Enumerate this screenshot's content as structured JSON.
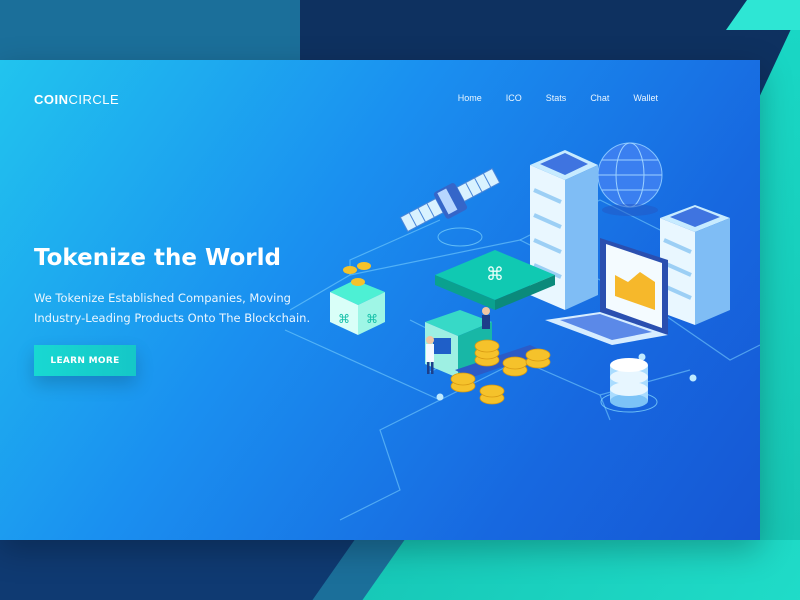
{
  "brand": {
    "logo_bold": "COIN",
    "logo_rest": "CIRCLE"
  },
  "nav": {
    "items": [
      "Home",
      "ICO",
      "Stats",
      "Chat",
      "Wallet"
    ]
  },
  "hero": {
    "title": "Tokenize the World",
    "subtitle": "We Tokenize Established Companies, Moving Industry-Leading Products Onto The Blockchain.",
    "cta_label": "LEARN MORE"
  },
  "colors": {
    "accent": "#18d8d2",
    "card_start": "#21c4ee",
    "card_end": "#1657d4",
    "navy": "#0e3160",
    "mint": "#19d8c6"
  },
  "illustration": {
    "icons": [
      "satellite-icon",
      "globe-icon",
      "server-tower-icon",
      "laptop-chart-icon",
      "token-box-icon",
      "coin-stack-icon",
      "database-icon",
      "machine-icon",
      "person-icon"
    ]
  }
}
